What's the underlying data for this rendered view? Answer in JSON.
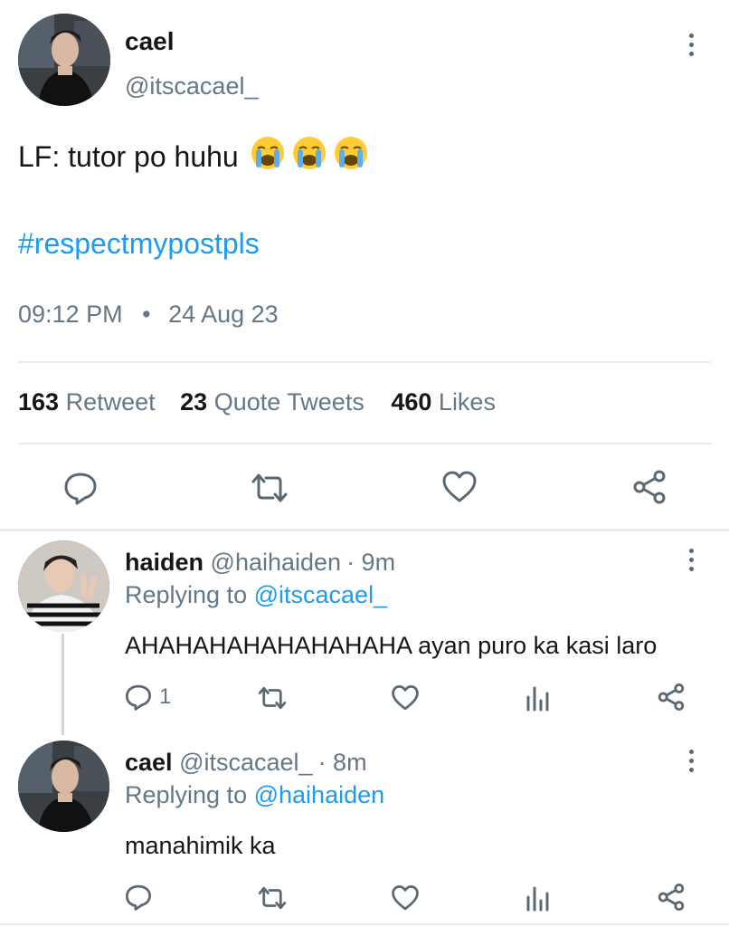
{
  "main_tweet": {
    "display_name": "cael",
    "handle": "@itscacael_",
    "text": "LF: tutor po huhu",
    "emojis": [
      "loudly-crying-face",
      "loudly-crying-face",
      "loudly-crying-face"
    ],
    "hashtag": "#respectmypostpls",
    "time": "09:12 PM",
    "separator": "•",
    "date": "24 Aug 23",
    "stats": {
      "retweets_count": "163",
      "retweets_label": "Retweet",
      "quotes_count": "23",
      "quotes_label": "Quote Tweets",
      "likes_count": "460",
      "likes_label": "Likes"
    }
  },
  "replies": [
    {
      "display_name": "haiden",
      "handle": "@haihaiden",
      "age": "· 9m",
      "replying_prefix": "Replying to",
      "replying_to": "@itscacael_",
      "text": "AHAHAHAHAHAHAHAHA ayan puro ka kasi laro",
      "reply_count": "1"
    },
    {
      "display_name": "cael",
      "handle": "@itscacael_",
      "age": "· 8m",
      "replying_prefix": "Replying to",
      "replying_to": "@haihaiden",
      "text": "manahimik ka",
      "reply_count": ""
    }
  ],
  "colors": {
    "link": "#1d9bf0",
    "muted": "#657786",
    "divider": "#e6ecf0",
    "icon": "#5b6873"
  }
}
